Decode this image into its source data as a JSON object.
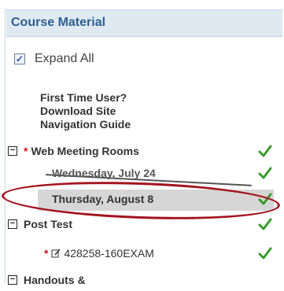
{
  "panel": {
    "title": "Course Material"
  },
  "expand_all": {
    "label": "Expand All",
    "checked": true
  },
  "guide": {
    "line1": "First Time User?",
    "line2": "Download Site",
    "line3": "Navigation Guide"
  },
  "tree": {
    "web_meeting_rooms": {
      "label": "Web Meeting Rooms",
      "star": "*",
      "toggle": "−"
    },
    "wednesday": {
      "label": "Wednesday, July 24"
    },
    "thursday": {
      "label": "Thursday, August 8"
    },
    "post_test": {
      "label": "Post Test",
      "toggle": "−"
    },
    "exam": {
      "label": "428258-160EXAM",
      "star": "*"
    },
    "handouts": {
      "label": "Handouts &",
      "toggle": "−"
    }
  },
  "icons": {
    "complete": "green-check-icon",
    "edit": "edit-icon",
    "collapse": "minus-box-icon"
  },
  "colors": {
    "accent": "#2f5f8f",
    "check": "#3a9a2e",
    "annotation": "#a3141f",
    "required": "#d01a1a"
  }
}
